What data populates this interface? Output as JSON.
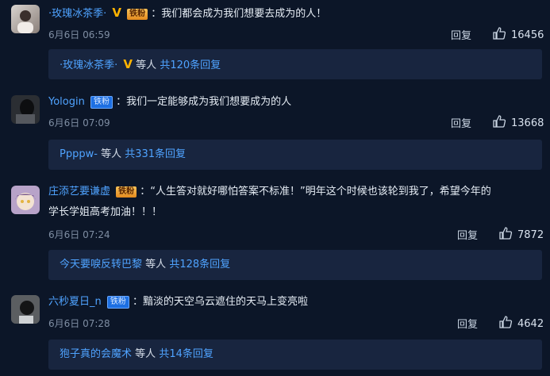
{
  "comments": [
    {
      "user": "·玫瑰冰茶季·",
      "badge": "铁粉",
      "text": "：我们都会成为我们想要去成为的人！",
      "time": "6月6日 06:59",
      "reply_label": "回复",
      "likes": "16456",
      "sub_user": "·玫瑰冰茶季·",
      "sub_mid": "等人",
      "sub_count": "共120条回复"
    },
    {
      "user": "Yologin",
      "badge": "铁粉",
      "text": "：我们一定能够成为我们想要成为的人",
      "time": "6月6日 07:09",
      "reply_label": "回复",
      "likes": "13668",
      "sub_user": "Ppppw-",
      "sub_mid": "等人",
      "sub_count": "共331条回复"
    },
    {
      "user": "庄添艺要谦虚",
      "badge": "铁粉",
      "text": "：“人生答对就好哪怕答案不标准！”明年这个时候也该轮到我了，希望今年的",
      "text2": "学长学姐高考加油！！！",
      "time": "6月6日 07:24",
      "reply_label": "回复",
      "likes": "7872",
      "sub_user": "今天要唳反转巴黎",
      "sub_mid": "等人",
      "sub_count": "共128条回复"
    },
    {
      "user": "六秒夏日_n",
      "badge": "铁粉",
      "text": "：黯淡的天空乌云遮住的天马上变亮啦",
      "time": "6月6日 07:28",
      "reply_label": "回复",
      "likes": "4642",
      "sub_user": "狍子真的会魔术",
      "sub_mid": "等人",
      "sub_count": "共14条回复"
    }
  ]
}
